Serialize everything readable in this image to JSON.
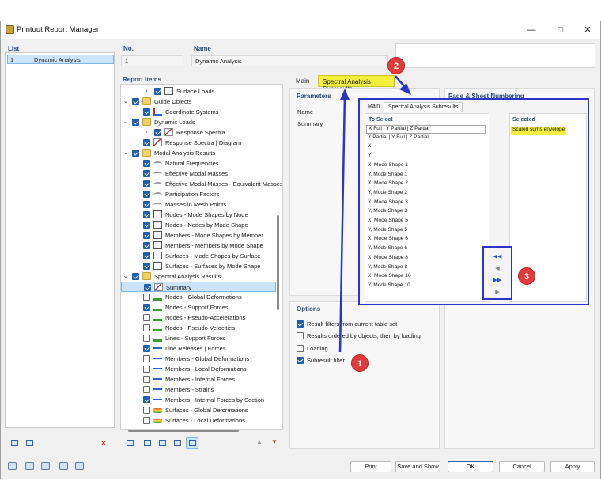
{
  "window": {
    "title": "Printout Report Manager"
  },
  "list": {
    "label": "List",
    "items": [
      {
        "number": "1",
        "name": "Dynamic Analysis"
      }
    ]
  },
  "header": {
    "no_label": "No.",
    "no_value": "1",
    "name_label": "Name",
    "name_value": "Dynamic Analysis"
  },
  "report_items": {
    "label": "Report Items",
    "rows": [
      {
        "label": "Surface Loads",
        "indent": 2,
        "checked": true,
        "chevron": ">",
        "icon": "mesh"
      },
      {
        "label": "Guide Objects",
        "indent": 0,
        "checked": true,
        "chevron": "v",
        "icon": "folder"
      },
      {
        "label": "Coordinate Systems",
        "indent": 1,
        "checked": true,
        "chevron": "",
        "icon": "cs"
      },
      {
        "label": "Dynamic Loads",
        "indent": 0,
        "checked": true,
        "chevron": "v",
        "icon": "folder"
      },
      {
        "label": "Response Spectra",
        "indent": 2,
        "checked": true,
        "chevron": ">",
        "icon": "graph"
      },
      {
        "label": "Response Spectra | Diagram",
        "indent": 1,
        "checked": true,
        "chevron": "",
        "icon": "graph"
      },
      {
        "label": "Modal Analysis Results",
        "indent": 0,
        "checked": true,
        "chevron": "v",
        "icon": "folder"
      },
      {
        "label": "Natural Frequencies",
        "indent": 1,
        "checked": true,
        "chevron": "",
        "icon": "wave"
      },
      {
        "label": "Effective Modal Masses",
        "indent": 1,
        "checked": true,
        "chevron": "",
        "icon": "wave"
      },
      {
        "label": "Effective Modal Masses - Equivalent Masses",
        "indent": 1,
        "checked": true,
        "chevron": "",
        "icon": "wave"
      },
      {
        "label": "Participation Factors",
        "indent": 1,
        "checked": true,
        "chevron": "",
        "icon": "wave"
      },
      {
        "label": "Masses in Mesh Points",
        "indent": 1,
        "checked": true,
        "chevron": "",
        "icon": "wave"
      },
      {
        "label": "Nodes - Mode Shapes by Node",
        "indent": 1,
        "checked": true,
        "chevron": "",
        "icon": "mesh"
      },
      {
        "label": "Nodes - Nodes by Mode Shape",
        "indent": 1,
        "checked": true,
        "chevron": "",
        "icon": "mesh"
      },
      {
        "label": "Members - Mode Shapes by Member",
        "indent": 1,
        "checked": true,
        "chevron": "",
        "icon": "mesh"
      },
      {
        "label": "Members - Members by Mode Shape",
        "indent": 1,
        "checked": true,
        "chevron": "",
        "icon": "mesh"
      },
      {
        "label": "Surfaces - Mode Shapes by Surface",
        "indent": 1,
        "checked": true,
        "chevron": "",
        "icon": "mesh"
      },
      {
        "label": "Surfaces - Surfaces by Mode Shape",
        "indent": 1,
        "checked": true,
        "chevron": "",
        "icon": "mesh"
      },
      {
        "label": "Spectral Analysis Results",
        "indent": 0,
        "checked": true,
        "chevron": "v",
        "icon": "folder"
      },
      {
        "label": "Summary",
        "indent": 1,
        "checked": true,
        "chevron": "",
        "icon": "graph",
        "selected": true
      },
      {
        "label": "Nodes - Global Deformations",
        "indent": 1,
        "checked": false,
        "chevron": "",
        "icon": "sup"
      },
      {
        "label": "Nodes - Support Forces",
        "indent": 1,
        "checked": true,
        "chevron": "",
        "icon": "sup"
      },
      {
        "label": "Nodes - Pseudo-Accelerations",
        "indent": 1,
        "checked": false,
        "chevron": "",
        "icon": "sup"
      },
      {
        "label": "Nodes - Pseudo-Velocities",
        "indent": 1,
        "checked": false,
        "chevron": "",
        "icon": "sup"
      },
      {
        "label": "Lines - Support Forces",
        "indent": 1,
        "checked": false,
        "chevron": "",
        "icon": "sup"
      },
      {
        "label": "Line Releases | Forces",
        "indent": 1,
        "checked": true,
        "chevron": "",
        "icon": "memb"
      },
      {
        "label": "Members - Global Deformations",
        "indent": 1,
        "checked": false,
        "chevron": "",
        "icon": "memb"
      },
      {
        "label": "Members - Local Deformations",
        "indent": 1,
        "checked": false,
        "chevron": "",
        "icon": "memb"
      },
      {
        "label": "Members - Internal Forces",
        "indent": 1,
        "checked": false,
        "chevron": "",
        "icon": "memb"
      },
      {
        "label": "Members - Strains",
        "indent": 1,
        "checked": false,
        "chevron": "",
        "icon": "memb"
      },
      {
        "label": "Members - Internal Forces by Section",
        "indent": 1,
        "checked": true,
        "chevron": "",
        "icon": "memb"
      },
      {
        "label": "Surfaces - Global Deformations",
        "indent": 1,
        "checked": false,
        "chevron": "",
        "icon": "surf"
      },
      {
        "label": "Surfaces - Local Deformations",
        "indent": 1,
        "checked": false,
        "chevron": "",
        "icon": "surf"
      }
    ]
  },
  "tabs": {
    "main": "Main",
    "spectral": "Spectral Analysis Subresults"
  },
  "parameters": {
    "label": "Parameters",
    "name_label": "Name",
    "summary": "Summary"
  },
  "page_sheet": {
    "label": "Page & Sheet Numbering"
  },
  "options": {
    "label": "Options",
    "items": [
      {
        "label": "Result filters from current table set",
        "checked": true
      },
      {
        "label": "Results ordered by objects, then by loading",
        "checked": false
      },
      {
        "label": "Loading",
        "checked": false
      },
      {
        "label": "Subresult filter",
        "checked": true
      }
    ]
  },
  "popup": {
    "tab_main": "Main",
    "tab_spectral": "Spectral Analysis Subresults",
    "to_select_label": "To Select",
    "selected_label": "Selected",
    "to_select": [
      "X Full | Y Partial | Z Partial",
      "X Partial | Y Full | Z Partial",
      "X",
      "Y",
      "X, Mode Shape 1",
      "Y, Mode Shape 1",
      "X, Mode Shape 2",
      "Y, Mode Shape 2",
      "X, Mode Shape 3",
      "Y, Mode Shape 3",
      "X, Mode Shape 5",
      "Y, Mode Shape 5",
      "X, Mode Shape 6",
      "Y, Mode Shape 6",
      "X, Mode Shape 8",
      "Y, Mode Shape 8",
      "X, Mode Shape 10",
      "Y, Mode Shape 10"
    ],
    "selected": [
      "Scaled sums envelope"
    ],
    "move_buttons": [
      "◀◀",
      "◀",
      "▶▶",
      "▶"
    ]
  },
  "callouts": [
    "1",
    "2",
    "3"
  ],
  "buttons": {
    "print": "Print",
    "save_and_show": "Save and Show",
    "ok": "OK",
    "cancel": "Cancel",
    "apply": "Apply"
  },
  "colors": {
    "highlight": "#f2ef3d",
    "frame": "#2b35c9",
    "callout": "#e23b3b"
  }
}
